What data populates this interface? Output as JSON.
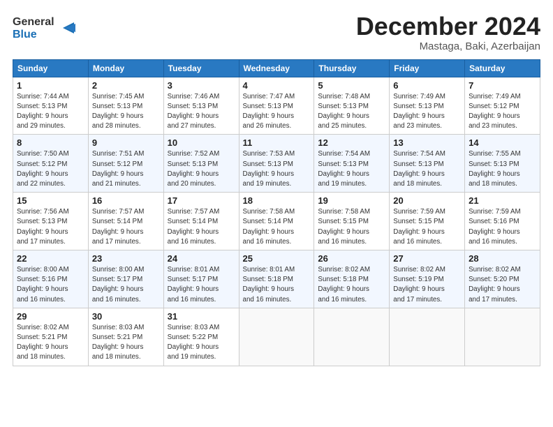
{
  "logo": {
    "line1": "General",
    "line2": "Blue"
  },
  "header": {
    "month": "December 2024",
    "location": "Mastaga, Baki, Azerbaijan"
  },
  "weekdays": [
    "Sunday",
    "Monday",
    "Tuesday",
    "Wednesday",
    "Thursday",
    "Friday",
    "Saturday"
  ],
  "weeks": [
    [
      {
        "day": "1",
        "info": "Sunrise: 7:44 AM\nSunset: 5:13 PM\nDaylight: 9 hours\nand 29 minutes."
      },
      {
        "day": "2",
        "info": "Sunrise: 7:45 AM\nSunset: 5:13 PM\nDaylight: 9 hours\nand 28 minutes."
      },
      {
        "day": "3",
        "info": "Sunrise: 7:46 AM\nSunset: 5:13 PM\nDaylight: 9 hours\nand 27 minutes."
      },
      {
        "day": "4",
        "info": "Sunrise: 7:47 AM\nSunset: 5:13 PM\nDaylight: 9 hours\nand 26 minutes."
      },
      {
        "day": "5",
        "info": "Sunrise: 7:48 AM\nSunset: 5:13 PM\nDaylight: 9 hours\nand 25 minutes."
      },
      {
        "day": "6",
        "info": "Sunrise: 7:49 AM\nSunset: 5:13 PM\nDaylight: 9 hours\nand 23 minutes."
      },
      {
        "day": "7",
        "info": "Sunrise: 7:49 AM\nSunset: 5:12 PM\nDaylight: 9 hours\nand 23 minutes."
      }
    ],
    [
      {
        "day": "8",
        "info": "Sunrise: 7:50 AM\nSunset: 5:12 PM\nDaylight: 9 hours\nand 22 minutes."
      },
      {
        "day": "9",
        "info": "Sunrise: 7:51 AM\nSunset: 5:12 PM\nDaylight: 9 hours\nand 21 minutes."
      },
      {
        "day": "10",
        "info": "Sunrise: 7:52 AM\nSunset: 5:13 PM\nDaylight: 9 hours\nand 20 minutes."
      },
      {
        "day": "11",
        "info": "Sunrise: 7:53 AM\nSunset: 5:13 PM\nDaylight: 9 hours\nand 19 minutes."
      },
      {
        "day": "12",
        "info": "Sunrise: 7:54 AM\nSunset: 5:13 PM\nDaylight: 9 hours\nand 19 minutes."
      },
      {
        "day": "13",
        "info": "Sunrise: 7:54 AM\nSunset: 5:13 PM\nDaylight: 9 hours\nand 18 minutes."
      },
      {
        "day": "14",
        "info": "Sunrise: 7:55 AM\nSunset: 5:13 PM\nDaylight: 9 hours\nand 18 minutes."
      }
    ],
    [
      {
        "day": "15",
        "info": "Sunrise: 7:56 AM\nSunset: 5:13 PM\nDaylight: 9 hours\nand 17 minutes."
      },
      {
        "day": "16",
        "info": "Sunrise: 7:57 AM\nSunset: 5:14 PM\nDaylight: 9 hours\nand 17 minutes."
      },
      {
        "day": "17",
        "info": "Sunrise: 7:57 AM\nSunset: 5:14 PM\nDaylight: 9 hours\nand 16 minutes."
      },
      {
        "day": "18",
        "info": "Sunrise: 7:58 AM\nSunset: 5:14 PM\nDaylight: 9 hours\nand 16 minutes."
      },
      {
        "day": "19",
        "info": "Sunrise: 7:58 AM\nSunset: 5:15 PM\nDaylight: 9 hours\nand 16 minutes."
      },
      {
        "day": "20",
        "info": "Sunrise: 7:59 AM\nSunset: 5:15 PM\nDaylight: 9 hours\nand 16 minutes."
      },
      {
        "day": "21",
        "info": "Sunrise: 7:59 AM\nSunset: 5:16 PM\nDaylight: 9 hours\nand 16 minutes."
      }
    ],
    [
      {
        "day": "22",
        "info": "Sunrise: 8:00 AM\nSunset: 5:16 PM\nDaylight: 9 hours\nand 16 minutes."
      },
      {
        "day": "23",
        "info": "Sunrise: 8:00 AM\nSunset: 5:17 PM\nDaylight: 9 hours\nand 16 minutes."
      },
      {
        "day": "24",
        "info": "Sunrise: 8:01 AM\nSunset: 5:17 PM\nDaylight: 9 hours\nand 16 minutes."
      },
      {
        "day": "25",
        "info": "Sunrise: 8:01 AM\nSunset: 5:18 PM\nDaylight: 9 hours\nand 16 minutes."
      },
      {
        "day": "26",
        "info": "Sunrise: 8:02 AM\nSunset: 5:18 PM\nDaylight: 9 hours\nand 16 minutes."
      },
      {
        "day": "27",
        "info": "Sunrise: 8:02 AM\nSunset: 5:19 PM\nDaylight: 9 hours\nand 17 minutes."
      },
      {
        "day": "28",
        "info": "Sunrise: 8:02 AM\nSunset: 5:20 PM\nDaylight: 9 hours\nand 17 minutes."
      }
    ],
    [
      {
        "day": "29",
        "info": "Sunrise: 8:02 AM\nSunset: 5:21 PM\nDaylight: 9 hours\nand 18 minutes."
      },
      {
        "day": "30",
        "info": "Sunrise: 8:03 AM\nSunset: 5:21 PM\nDaylight: 9 hours\nand 18 minutes."
      },
      {
        "day": "31",
        "info": "Sunrise: 8:03 AM\nSunset: 5:22 PM\nDaylight: 9 hours\nand 19 minutes."
      },
      null,
      null,
      null,
      null
    ]
  ]
}
